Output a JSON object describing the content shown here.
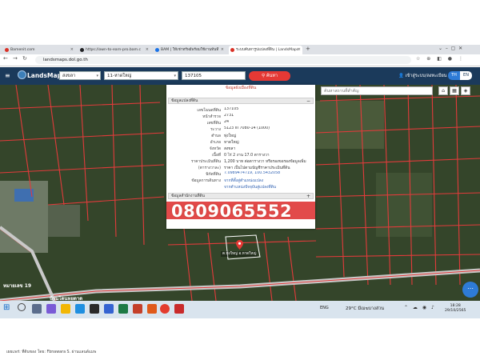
{
  "browser": {
    "tabs": [
      {
        "label": "Bamenit.com",
        "favicon_color": "#d93025"
      },
      {
        "label": "https://own-to-earn-pro.bam.c",
        "favicon_color": "#202124"
      },
      {
        "label": "BAM | ให้เช่าทรัพย์พร้อมใช้งานทันที",
        "favicon_color": "#1a73e8"
      },
      {
        "label": "ระบบค้นหารูปแปลงที่ดิน | LandsMaps",
        "favicon_color": "#d93025"
      }
    ],
    "new_tab": "+",
    "url": "landsmaps.dol.go.th",
    "nav": {
      "back": "←",
      "forward": "→",
      "reload": "↻"
    }
  },
  "app": {
    "name": "LandsMaps",
    "province_select": "สงขลา",
    "district_select": "11-หาดใหญ่",
    "parcel_input": "137105",
    "search_button": "ค้นหา",
    "login": "เข้าสู่ระบบ/ลงทะเบียน",
    "lang": {
      "th": "TH",
      "en": "EN"
    },
    "place_search_placeholder": "ค้นหาสถานที่สำคัญ"
  },
  "popup": {
    "title": "ข้อมูลผังเมืองที่ดิน",
    "section1": "ข้อมูลแปลงที่ดิน",
    "toggle_collapse": "−",
    "fields": [
      {
        "label": "เลขโฉนดที่ดิน",
        "value": "137105",
        "link": false
      },
      {
        "label": "หน้าสำรวจ",
        "value": "2731",
        "link": false
      },
      {
        "label": "เลขที่ดิน",
        "value": "24",
        "link": false
      },
      {
        "label": "ระวาง",
        "value": "5123 III 7080-14 (1000)",
        "link": false
      },
      {
        "label": "ตำบล",
        "value": "ทุ่งใหญ่",
        "link": false
      },
      {
        "label": "อำเภอ",
        "value": "หาดใหญ่",
        "link": false
      },
      {
        "label": "จังหวัด",
        "value": "สงขลา",
        "link": false
      },
      {
        "label": "เนื้อที่",
        "value": "0 ไร่ 2 งาน 17.0 ตารางวา",
        "link": false
      },
      {
        "label": "ราคาประเมินที่ดิน",
        "value": "1,200 บาท ต่อตารางวา  หรือรองขอรองข้อมูลเพิ่ม",
        "link": false
      },
      {
        "label": "(ตารางวาละ)",
        "value": "ราคา เป็นไปตามบัญชีราคาประเมินที่ดิน",
        "link": false
      },
      {
        "label": "พิกัดที่ดิน",
        "value": "7.0989474719, 100.5432058",
        "link": true
      },
      {
        "label": "ข้อมูลการเดินทาง",
        "value": "จากที่ตั้งสู่ตำแหน่งแปลง",
        "link": true
      },
      {
        "label": "",
        "value": "จากตำแหน่งปัจจุบันสู่แปลงที่ดิน",
        "link": true
      }
    ],
    "section2": "ข้อมูลสำนักงานที่ดิน",
    "toggle_expand": "+",
    "phone": "0809065552"
  },
  "map": {
    "pin_label": "ต.ทุ่งใหญ่ อ.หาดใหญ่",
    "road_label": "บ้านโดนหยดาด",
    "road_number": "หมายเลข 19",
    "fab": "⋯"
  },
  "taskbar": {
    "lang": "ENG",
    "weather": "29°C  มีเมฆบางส่วน",
    "time": "18:28",
    "date": "29/10/2565"
  },
  "caption": "เผยแพร่: ที่ดินของ โดย: Fbnawara S. ผ่านแลนด์แมพ"
}
